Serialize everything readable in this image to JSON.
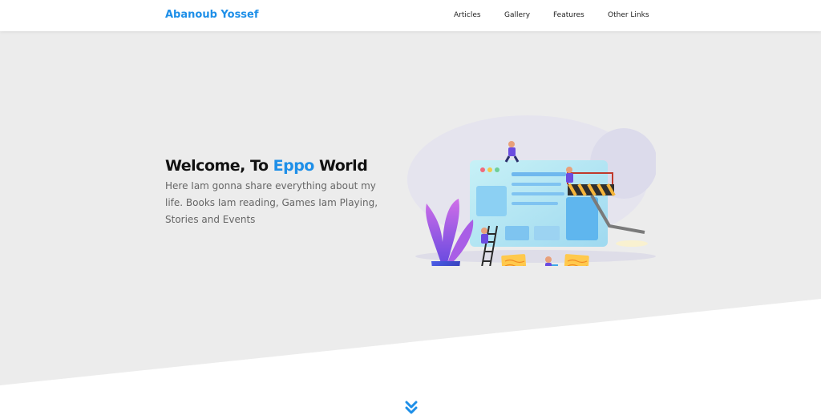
{
  "header": {
    "logo": "Abanoub Yossef",
    "nav": [
      "Articles",
      "Gallery",
      "Features",
      "Other Links"
    ]
  },
  "hero": {
    "title_prefix": "Welcome, To ",
    "title_accent": "Eppo",
    "title_suffix": " World",
    "description": "Here Iam gonna share everything about my life. Books Iam reading, Games Iam Playing, Stories and Events"
  },
  "icons": {
    "scroll": "double-chevron-down-icon"
  },
  "colors": {
    "accent": "#1e8fe8",
    "landing_bg": "#ececec",
    "text_dark": "#111111",
    "text_muted": "#666666"
  }
}
